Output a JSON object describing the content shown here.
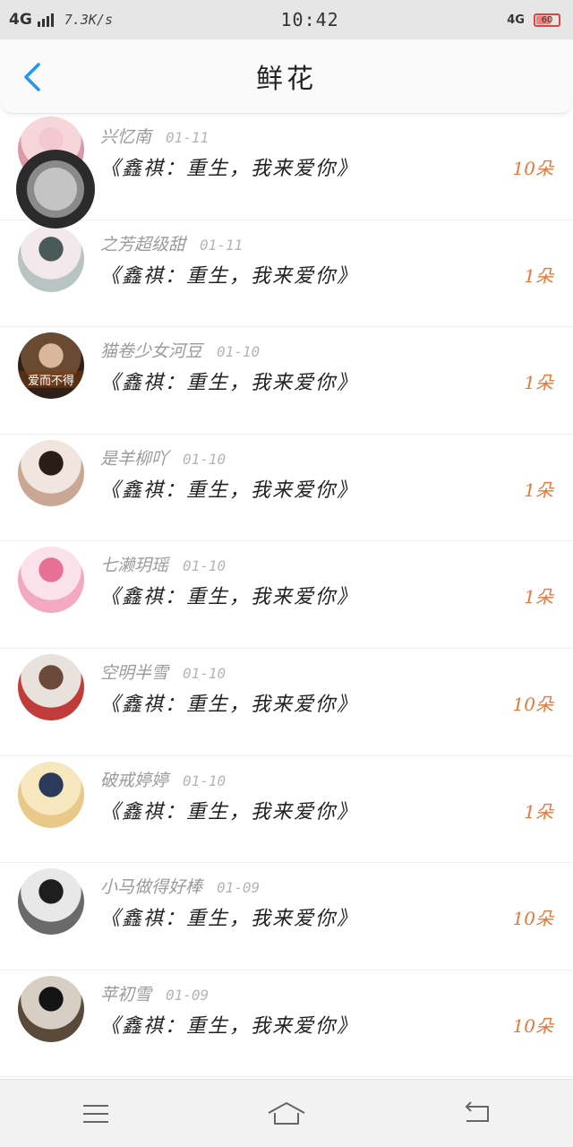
{
  "status_bar": {
    "network_left": "4G",
    "speed": "7.3K/s",
    "time": "10:42",
    "network_right": "4G",
    "battery_level": "60",
    "battery_color": "#f08080"
  },
  "header": {
    "title": "鲜花",
    "back_icon": "chevron-left-icon",
    "accent": "#2196f3"
  },
  "records": [
    {
      "user": "兴忆南",
      "date": "01-11",
      "book": "《鑫祺：重生，我来爱你》",
      "count": "10朵",
      "avatar": {
        "bg1": "#f6d6d9",
        "bg2": "#d99aa7",
        "fg": "#f3c9cf"
      }
    },
    {
      "user": "之芳超级甜",
      "date": "01-11",
      "book": "《鑫祺：重生，我来爱你》",
      "count": "1朵",
      "avatar": {
        "bg1": "#f3e8ec",
        "bg2": "#b8c4c2",
        "fg": "#4a5a58"
      }
    },
    {
      "user": "猫卷少女河豆",
      "date": "01-10",
      "book": "《鑫祺：重生，我来爱你》",
      "count": "1朵",
      "avatar": {
        "bg1": "#6b4a34",
        "bg2": "#2e2018",
        "fg": "#d9b79a"
      },
      "avatar_text": "爱而不得"
    },
    {
      "user": "是羊柳吖",
      "date": "01-10",
      "book": "《鑫祺：重生，我来爱你》",
      "count": "1朵",
      "avatar": {
        "bg1": "#f1e6df",
        "bg2": "#c9a794",
        "fg": "#2a1c16"
      }
    },
    {
      "user": "七濑玥瑶",
      "date": "01-10",
      "book": "《鑫祺：重生，我来爱你》",
      "count": "1朵",
      "avatar": {
        "bg1": "#fbe2ea",
        "bg2": "#f3a9c0",
        "fg": "#e86f95"
      }
    },
    {
      "user": "空明半雪",
      "date": "01-10",
      "book": "《鑫祺：重生，我来爱你》",
      "count": "10朵",
      "avatar": {
        "bg1": "#e9e2dc",
        "bg2": "#c23b3b",
        "fg": "#6b4a3c"
      }
    },
    {
      "user": "破戒婷婷",
      "date": "01-10",
      "book": "《鑫祺：重生，我来爱你》",
      "count": "1朵",
      "avatar": {
        "bg1": "#f7e7bf",
        "bg2": "#e9c98a",
        "fg": "#2a3a5a"
      }
    },
    {
      "user": "小马做得好棒",
      "date": "01-09",
      "book": "《鑫祺：重生，我来爱你》",
      "count": "10朵",
      "avatar": {
        "bg1": "#e8e8e8",
        "bg2": "#6a6a6a",
        "fg": "#1e1e1e"
      }
    },
    {
      "user": "苹初雪",
      "date": "01-09",
      "book": "《鑫祺：重生，我来爱你》",
      "count": "10朵",
      "avatar": {
        "bg1": "#d8cfc4",
        "bg2": "#5a4a3a",
        "fg": "#141414"
      }
    }
  ],
  "bottom_nav": {
    "items": [
      "menu-icon",
      "home-icon",
      "back-icon"
    ]
  },
  "floating_button": "assistive-touch-icon"
}
